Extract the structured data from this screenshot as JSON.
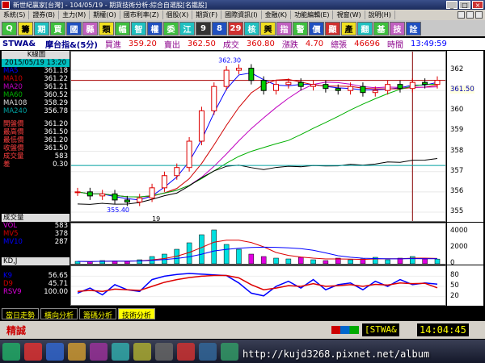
{
  "window": {
    "title": "新世紀贏家[台灣] - 104/05/19 - 期貨技術分析:綜合自選股[名鑑股]"
  },
  "menu": [
    "系統(S)",
    "證券(B)",
    "主力(M)",
    "期權(O)",
    "國市利率(Z)",
    "個股(X)",
    "期貨(F)",
    "國際資訊(I)",
    "金融(K)",
    "功能編輯(E)",
    "視窗(W)",
    "說明(H)"
  ],
  "toolbar": [
    "Q",
    "籌",
    "期",
    "買",
    "國",
    "縣",
    "類",
    "幅",
    "智",
    "權",
    "委",
    "江",
    "9",
    "8",
    "29",
    "核",
    "興",
    "指",
    "警",
    "價",
    "顯",
    "產",
    "翻",
    "基",
    "技",
    "詮"
  ],
  "quote": {
    "code": "STWA&",
    "name": "摩台指&(5分)",
    "buy_label": "買進",
    "buy": "359.20",
    "sell_label": "賣出",
    "last": "362.50",
    "last_label": "成交",
    "change": "360.80",
    "change_label": "漲跌",
    "volume": "4.70",
    "vol_label": "總張",
    "total": "46696",
    "time_label": "時間",
    "time": "13:49:59"
  },
  "info": {
    "date": "2015/05/19 13:20",
    "ma": [
      {
        "label": "MA5",
        "value": "361.18",
        "color": "#0000ff"
      },
      {
        "label": "MA10",
        "value": "361.22",
        "color": "#d00000"
      },
      {
        "label": "MA20",
        "value": "361.21",
        "color": "#c000c0"
      },
      {
        "label": "MA60",
        "value": "360.52",
        "color": "#00b000"
      },
      {
        "label": "MA108",
        "value": "358.29",
        "color": "#000000"
      },
      {
        "label": "MA240",
        "value": "356.78",
        "color": "#00a0a0"
      }
    ],
    "ohlc": [
      {
        "label": "開盤價",
        "value": "361.20"
      },
      {
        "label": "最高價",
        "value": "361.50"
      },
      {
        "label": "最低價",
        "value": "361.20"
      },
      {
        "label": "收盤價",
        "value": "361.50"
      },
      {
        "label": "成交量",
        "value": "583"
      },
      {
        "label": "差",
        "value": "0.30"
      }
    ],
    "vol_title": "成交量",
    "vol": [
      {
        "label": "VOL",
        "value": "583",
        "color": "#e000e0"
      },
      {
        "label": "MV5",
        "value": "378",
        "color": "#d00000"
      },
      {
        "label": "MV10",
        "value": "287",
        "color": "#0000ff"
      }
    ],
    "kd_title": "KD,J",
    "kd": [
      {
        "label": "K9",
        "value": "56.65",
        "color": "#0000ff"
      },
      {
        "label": "D9",
        "value": "45.71",
        "color": "#d00000"
      },
      {
        "label": "RSV9",
        "value": "100.00",
        "color": "#e000e0"
      }
    ],
    "kline_title": "K線圖"
  },
  "chart_data": {
    "type": "candlestick",
    "price_axis": {
      "ticks": [
        "362",
        "361",
        "360",
        "359",
        "358",
        "357",
        "356",
        "355"
      ],
      "current": "361.50"
    },
    "high_label": "362.30",
    "low_label": "355.40",
    "x_label": "19",
    "volume_axis": {
      "ticks": [
        "4000",
        "2000",
        "0"
      ]
    },
    "kd_axis": {
      "ticks": [
        "80",
        "50",
        "20"
      ]
    },
    "price": [
      356.0,
      355.8,
      355.9,
      355.6,
      355.5,
      355.7,
      356.2,
      356.8,
      357.2,
      358.5,
      360.0,
      361.2,
      362.0,
      362.1,
      361.5,
      361.0,
      361.3,
      361.4,
      361.2,
      361.3,
      361.1,
      361.0,
      361.2,
      360.9,
      361.0,
      361.3,
      361.1,
      361.4,
      361.3,
      361.5
    ],
    "volume": [
      300,
      250,
      400,
      350,
      300,
      500,
      900,
      1200,
      1800,
      2600,
      3600,
      4200,
      2400,
      1800,
      1200,
      900,
      700,
      600,
      800,
      500,
      400,
      700,
      500,
      600,
      800,
      500,
      700,
      900,
      600,
      583
    ],
    "k": [
      30,
      45,
      25,
      55,
      40,
      35,
      70,
      80,
      85,
      88,
      86,
      84,
      82,
      60,
      30,
      22,
      50,
      65,
      45,
      70,
      40,
      55,
      60,
      40,
      65,
      50,
      70,
      55,
      60,
      56.65
    ],
    "d": [
      35,
      38,
      35,
      42,
      40,
      38,
      50,
      62,
      70,
      76,
      80,
      82,
      82,
      75,
      55,
      40,
      45,
      52,
      50,
      58,
      50,
      52,
      55,
      50,
      56,
      54,
      60,
      58,
      59,
      45.71
    ]
  },
  "tabs": [
    "當日走勢",
    "橫向分析",
    "籌碼分析",
    "技術分析"
  ],
  "status": {
    "name": "精誠",
    "symbol": "[STWA&",
    "clock": "14:04:45"
  },
  "watermark": "http://kujd3268.pixnet.net/album"
}
